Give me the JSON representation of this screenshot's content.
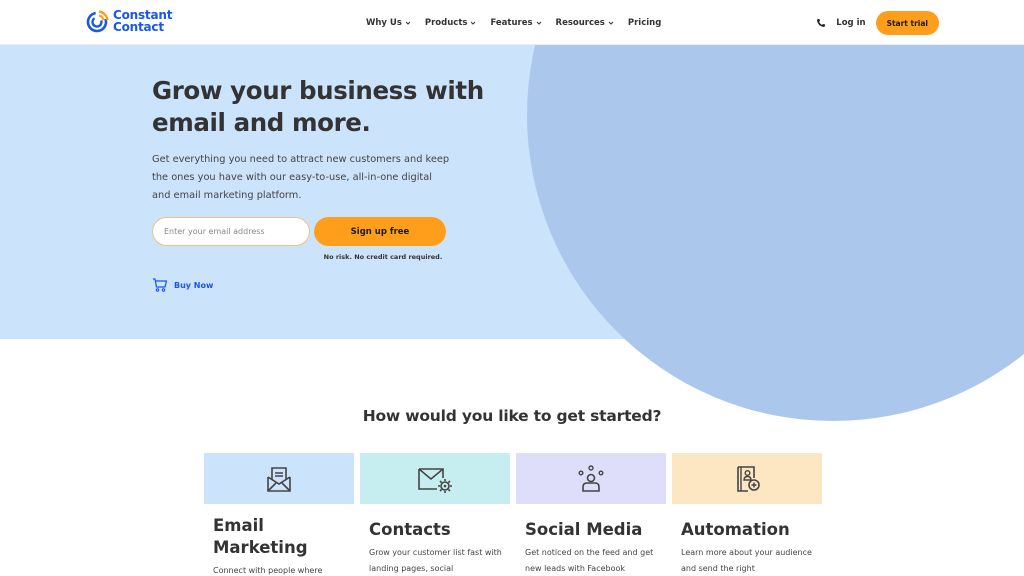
{
  "header": {
    "logo": {
      "line1": "Constant",
      "line2": "Contact",
      "icon": "constant-contact-logo-icon"
    },
    "nav": [
      {
        "label": "Why Us",
        "dropdown": true
      },
      {
        "label": "Products",
        "dropdown": true
      },
      {
        "label": "Features",
        "dropdown": true
      },
      {
        "label": "Resources",
        "dropdown": true
      },
      {
        "label": "Pricing",
        "dropdown": false
      }
    ],
    "phone_icon": "phone-icon",
    "login_label": "Log in",
    "start_trial_label": "Start trial"
  },
  "hero": {
    "title": "Grow your business with email and more.",
    "subtitle": "Get everything you need to attract new customers and keep the ones you have with our easy-to-use, all-in-one digital and email marketing platform.",
    "email_placeholder": "Enter your email address",
    "email_value": "",
    "signup_label": "Sign up free",
    "no_risk": "No risk. No credit card required.",
    "buy_now_label": "Buy Now",
    "buy_now_icon": "shopping-cart-icon"
  },
  "section": {
    "title": "How would you like to get started?",
    "cards": [
      {
        "title": "Email Marketing",
        "desc": "Connect with people where",
        "icon": "envelope-letter-icon",
        "color": "#cce3fc"
      },
      {
        "title": "Contacts",
        "desc": "Grow your customer list fast with landing pages, social",
        "icon": "envelope-gear-icon",
        "color": "#c6eef0"
      },
      {
        "title": "Social Media",
        "desc": "Get noticed on the feed and get new leads with Facebook",
        "icon": "social-people-icon",
        "color": "#dedefb"
      },
      {
        "title": "Automation",
        "desc": "Learn more about your audience and send the right",
        "icon": "contact-book-add-icon",
        "color": "#fde7c2"
      }
    ]
  },
  "colors": {
    "brand_blue": "#1856ed",
    "accent_orange": "#ff9e1b",
    "hero_bg": "#cce3fc",
    "hero_circle": "#abc8ec",
    "text_dark": "#333333"
  }
}
